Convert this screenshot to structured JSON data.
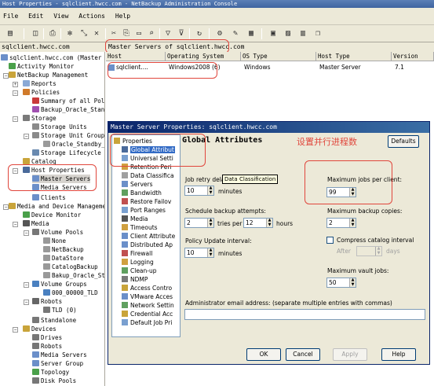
{
  "window": {
    "title": "Host Properties - sqlclient.hwcc.com - NetBackup Administration Console"
  },
  "menu": [
    "File",
    "Edit",
    "View",
    "Actions",
    "Help"
  ],
  "tree": {
    "header": "sqlclient.hwcc.com",
    "items": [
      "sqlclient.hwcc.com (Master S",
      "Activity Monitor",
      "NetBackup Management",
      "Reports",
      "Policies",
      "Summary of all Poli",
      "Backup_Oracle_Stand",
      "Storage",
      "Storage Units",
      "Storage Unit Groups",
      "Oracle_Standby_S",
      "Storage Lifecycle P",
      "Catalog",
      "Host Properties",
      "Master Servers",
      "Media Servers",
      "Clients",
      "Media and Device Manageme",
      "Device Monitor",
      "Media",
      "Volume Pools",
      "None",
      "NetBackup",
      "DataStore",
      "CatalogBackup",
      "Bakup_Oracle_Sta",
      "Volume Groups",
      "000_00000_TLD",
      "Robots",
      "TLD (0)",
      "Standalone",
      "Devices",
      "Drives",
      "Robots",
      "Media Servers",
      "Server Group",
      "Topology",
      "Disk Pools"
    ]
  },
  "list": {
    "title": "Master Servers of sqlclient.hwcc.com",
    "columns": [
      "Host",
      "Operating System",
      "OS Type",
      "Host Type",
      "Version"
    ],
    "rows": [
      [
        "sqlclient....",
        "Windows2008 (6)",
        "Windows",
        "Master Server",
        "7.1"
      ]
    ]
  },
  "dialog": {
    "title": "Master Server Properties: sqlclient.hwcc.com",
    "heading": "Global Attributes",
    "annotation": "设置并行进程数",
    "defaults_label": "Defaults",
    "properties": [
      "Properties",
      "Global Attribut",
      "Universal Setti",
      "Retention Peri",
      "Data Classifica",
      "Servers",
      "Bandwidth",
      "Restore Failov",
      "Port Ranges",
      "Media",
      "Timeouts",
      "Client Attribute",
      "Distributed Ap",
      "Firewall",
      "Logging",
      "Clean-up",
      "NDMP",
      "Access Contro",
      "VMware Acces",
      "Network Settin",
      "Credential Acc",
      "Default Job Pri"
    ],
    "tooltip": "Data Classification",
    "job_retry_label": "Job retry dela",
    "job_retry_value": "10",
    "job_retry_unit": "minutes",
    "schedule_label": "Schedule backup attempts:",
    "tries_value": "2",
    "tries_per": "tries per",
    "hours_value": "12",
    "hours_unit": "hours",
    "policy_update_label": "Policy Update interval:",
    "policy_update_value": "10",
    "policy_update_unit": "minutes",
    "max_jobs_label": "Maximum jobs per client:",
    "max_jobs_value": "99",
    "max_copies_label": "Maximum backup copies:",
    "max_copies_value": "2",
    "compress_label": "Compress catalog interval",
    "after_label": "After",
    "days_label": "days",
    "max_vault_label": "Maximum vault jobs:",
    "max_vault_value": "50",
    "email_label": "Administrator email address: (separate multiple entries with commas)",
    "email_value": "",
    "buttons": {
      "ok": "OK",
      "cancel": "Cancel",
      "apply": "Apply",
      "help": "Help"
    }
  },
  "colors": {
    "annotation_red": "#e0463c",
    "selection_blue": "#316ac5",
    "chrome": "#ece9d8"
  }
}
